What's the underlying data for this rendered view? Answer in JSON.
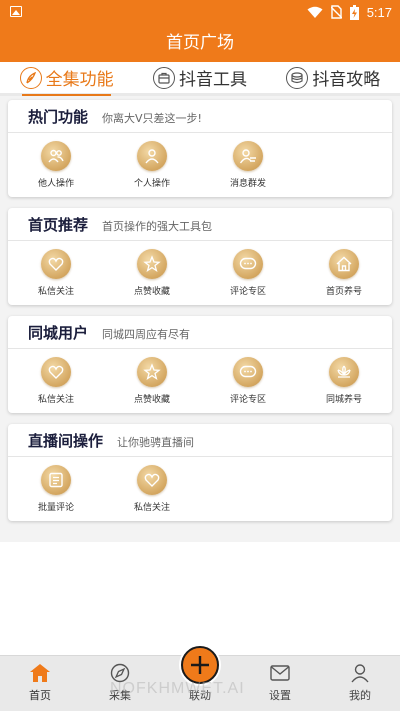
{
  "status": {
    "time": "5:17"
  },
  "header": {
    "title": "首页广场"
  },
  "tabs": [
    {
      "label": "全集功能",
      "icon": "feather-icon"
    },
    {
      "label": "抖音工具",
      "icon": "toolbox-icon"
    },
    {
      "label": "抖音攻略",
      "icon": "database-icon"
    }
  ],
  "sections": [
    {
      "title": "热门功能",
      "subtitle": "你离大V只差这一步!",
      "items": [
        {
          "label": "他人操作",
          "icon": "users-icon"
        },
        {
          "label": "个人操作",
          "icon": "user-icon"
        },
        {
          "label": "消息群发",
          "icon": "user-message-icon"
        }
      ]
    },
    {
      "title": "首页推荐",
      "subtitle": "首页操作的强大工具包",
      "items": [
        {
          "label": "私信关注",
          "icon": "heart-icon"
        },
        {
          "label": "点赞收藏",
          "icon": "star-icon"
        },
        {
          "label": "评论专区",
          "icon": "comment-icon"
        },
        {
          "label": "首页养号",
          "icon": "home-icon"
        }
      ]
    },
    {
      "title": "同城用户",
      "subtitle": "同城四周应有尽有",
      "items": [
        {
          "label": "私信关注",
          "icon": "heart-icon"
        },
        {
          "label": "点赞收藏",
          "icon": "star-icon"
        },
        {
          "label": "评论专区",
          "icon": "comment-icon"
        },
        {
          "label": "同城养号",
          "icon": "lotus-icon"
        }
      ]
    },
    {
      "title": "直播间操作",
      "subtitle": "让你驰骋直播间",
      "items": [
        {
          "label": "批量评论",
          "icon": "list-icon"
        },
        {
          "label": "私信关注",
          "icon": "heart-icon"
        }
      ]
    }
  ],
  "nav": [
    {
      "label": "首页",
      "icon": "home-icon"
    },
    {
      "label": "采集",
      "icon": "compass-icon"
    },
    {
      "label": "联动",
      "icon": "plus-icon"
    },
    {
      "label": "设置",
      "icon": "mail-icon"
    },
    {
      "label": "我的",
      "icon": "person-icon"
    }
  ],
  "watermark": "NOFKHMWET.AI",
  "colors": {
    "brand": "#ef7a1a",
    "gold": "#d4a761",
    "title": "#1b1e3c"
  }
}
